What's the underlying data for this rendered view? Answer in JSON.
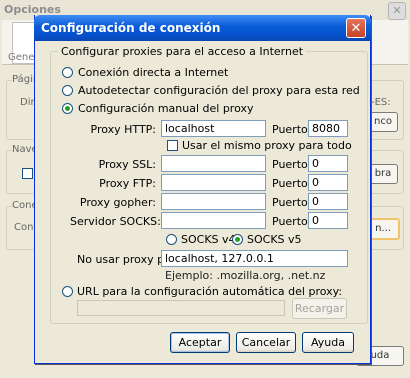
{
  "background_window": {
    "title": "Opciones",
    "close_label": "✕",
    "tab_label": "Gener",
    "group1_label": "Págin",
    "group1_text": "Direc",
    "lang_fragment": "-ES:",
    "btn_fragment": "nco",
    "group2_label": "Nave",
    "group2_btn": "bra",
    "group3_label": "Cone",
    "group3_text": "Conf",
    "group3_btn": "n...",
    "bottom_btn": "uda"
  },
  "dialog": {
    "title": "Configuración de conexión",
    "close_label": "✕",
    "group_label": "Configurar proxies para el acceso a Internet",
    "options": {
      "direct": "Conexión directa a Internet",
      "autodetect": "Autodetectar configuración del proxy para esta red",
      "manual": "Configuración manual del proxy",
      "auto_url": "URL para la configuración automática del proxy:"
    },
    "selected_option": "manual",
    "http": {
      "label": "Proxy HTTP:",
      "value": "localhost",
      "port_label": "Puerto:",
      "port": "8080"
    },
    "same_proxy_label": "Usar el mismo proxy para todo",
    "same_proxy_checked": false,
    "ssl": {
      "label": "Proxy SSL:",
      "value": "",
      "port_label": "Puerto:",
      "port": "0"
    },
    "ftp": {
      "label": "Proxy FTP:",
      "value": "",
      "port_label": "Puerto:",
      "port": "0"
    },
    "gopher": {
      "label": "Proxy gopher:",
      "value": "",
      "port_label": "Puerto:",
      "port": "0"
    },
    "socks": {
      "label": "Servidor SOCKS:",
      "value": "",
      "port_label": "Puerto:",
      "port": "0"
    },
    "socks_v4": "SOCKS v4",
    "socks_v5": "SOCKS v5",
    "socks_selected": "v5",
    "no_proxy_label": "No usar proxy para:",
    "no_proxy_value": "localhost, 127.0.0.1",
    "example": "Ejemplo: .mozilla.org, .net.nz",
    "auto_url_value": "",
    "reload_label": "Recargar",
    "buttons": {
      "accept": "Aceptar",
      "cancel": "Cancelar",
      "help": "Ayuda"
    }
  }
}
